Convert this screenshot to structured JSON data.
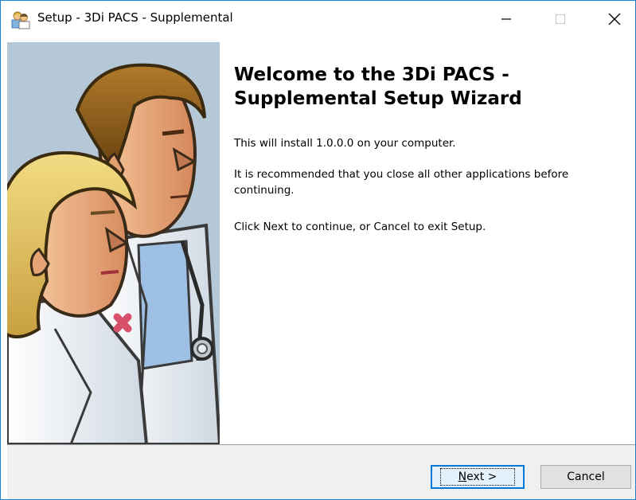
{
  "window": {
    "title": "Setup - 3Di PACS - Supplemental",
    "accent": "#1883d7"
  },
  "icons": {
    "app": "setup-people-icon",
    "minimize": "minimize-icon",
    "maximize": "maximize-icon",
    "close": "close-icon"
  },
  "wizard": {
    "title_line1": "Welcome to the 3Di PACS -",
    "title_line2": "Supplemental Setup Wizard",
    "para1": "This will install 1.0.0.0 on your computer.",
    "para2": "It is recommended that you close all other applications before continuing.",
    "para3": "Click Next to continue, or Cancel to exit Setup."
  },
  "buttons": {
    "next_accel": "N",
    "next_rest": "ext >",
    "cancel": "Cancel"
  }
}
